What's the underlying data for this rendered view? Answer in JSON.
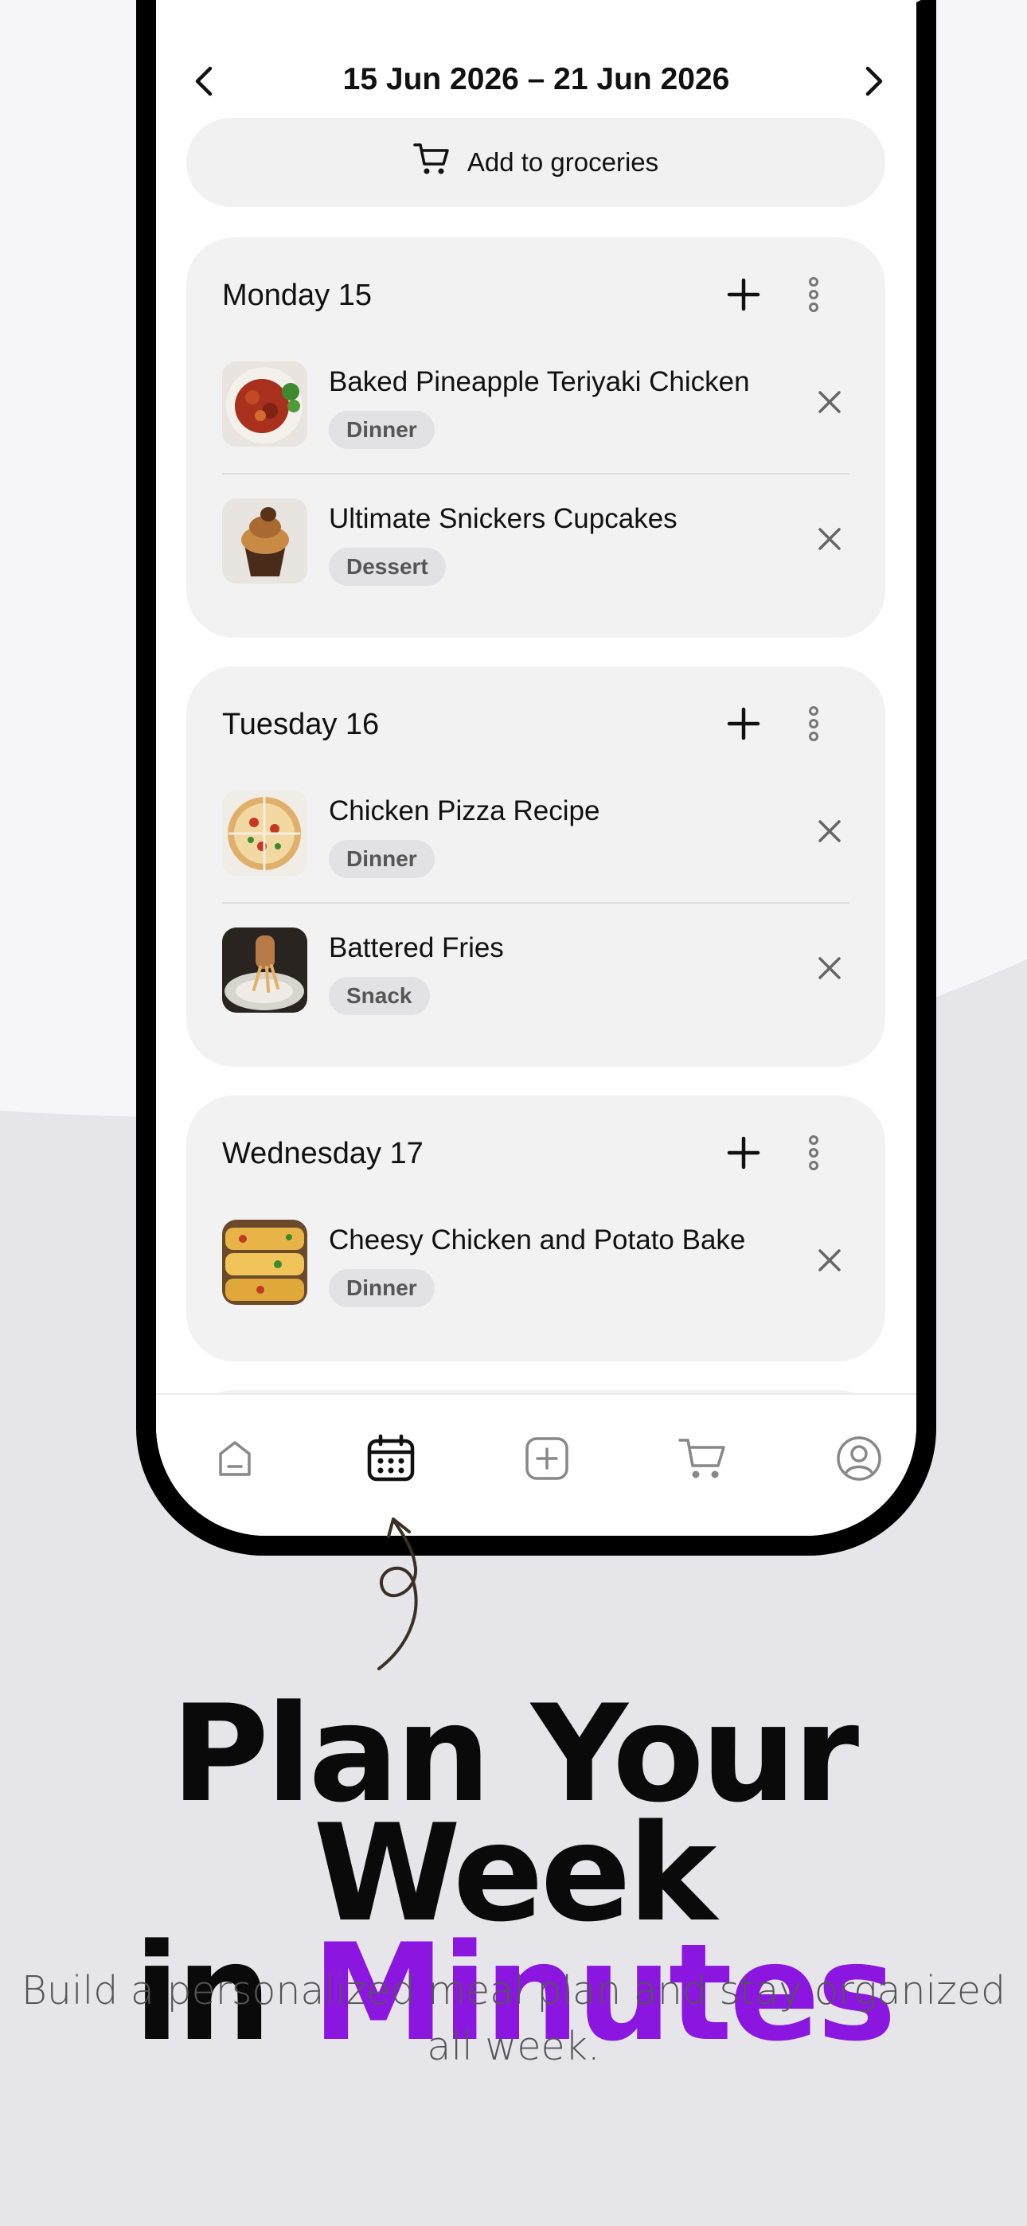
{
  "week": {
    "title": "15 Jun 2026 – 21 Jun 2026",
    "prev_icon": "chevron-left-icon",
    "next_icon": "chevron-right-icon"
  },
  "groceries_button": {
    "label": "Add to groceries",
    "icon": "cart-icon"
  },
  "days": [
    {
      "label": "Monday 15",
      "meals": [
        {
          "name": "Baked Pineapple Teriyaki Chicken",
          "tag": "Dinner"
        },
        {
          "name": "Ultimate Snickers Cupcakes",
          "tag": "Dessert"
        }
      ]
    },
    {
      "label": "Tuesday 16",
      "meals": [
        {
          "name": "Chicken Pizza Recipe",
          "tag": "Dinner"
        },
        {
          "name": "Battered Fries",
          "tag": "Snack"
        }
      ]
    },
    {
      "label": "Wednesday 17",
      "meals": [
        {
          "name": "Cheesy Chicken and Potato Bake",
          "tag": "Dinner"
        }
      ]
    }
  ],
  "nav": [
    {
      "name": "home-icon",
      "active": false
    },
    {
      "name": "calendar-icon",
      "active": true
    },
    {
      "name": "add-square-icon",
      "active": false
    },
    {
      "name": "cart-icon",
      "active": false
    },
    {
      "name": "profile-icon",
      "active": false
    }
  ],
  "marketing": {
    "headline_line1": "Plan Your Week",
    "headline_in": "in",
    "headline_accent": "Minutes",
    "subtitle": "Build a personalized meal plan and stay organized all week."
  },
  "colors": {
    "accent": "#8a16e0",
    "background": "#e6e5ea",
    "card": "#f2f2f3"
  }
}
